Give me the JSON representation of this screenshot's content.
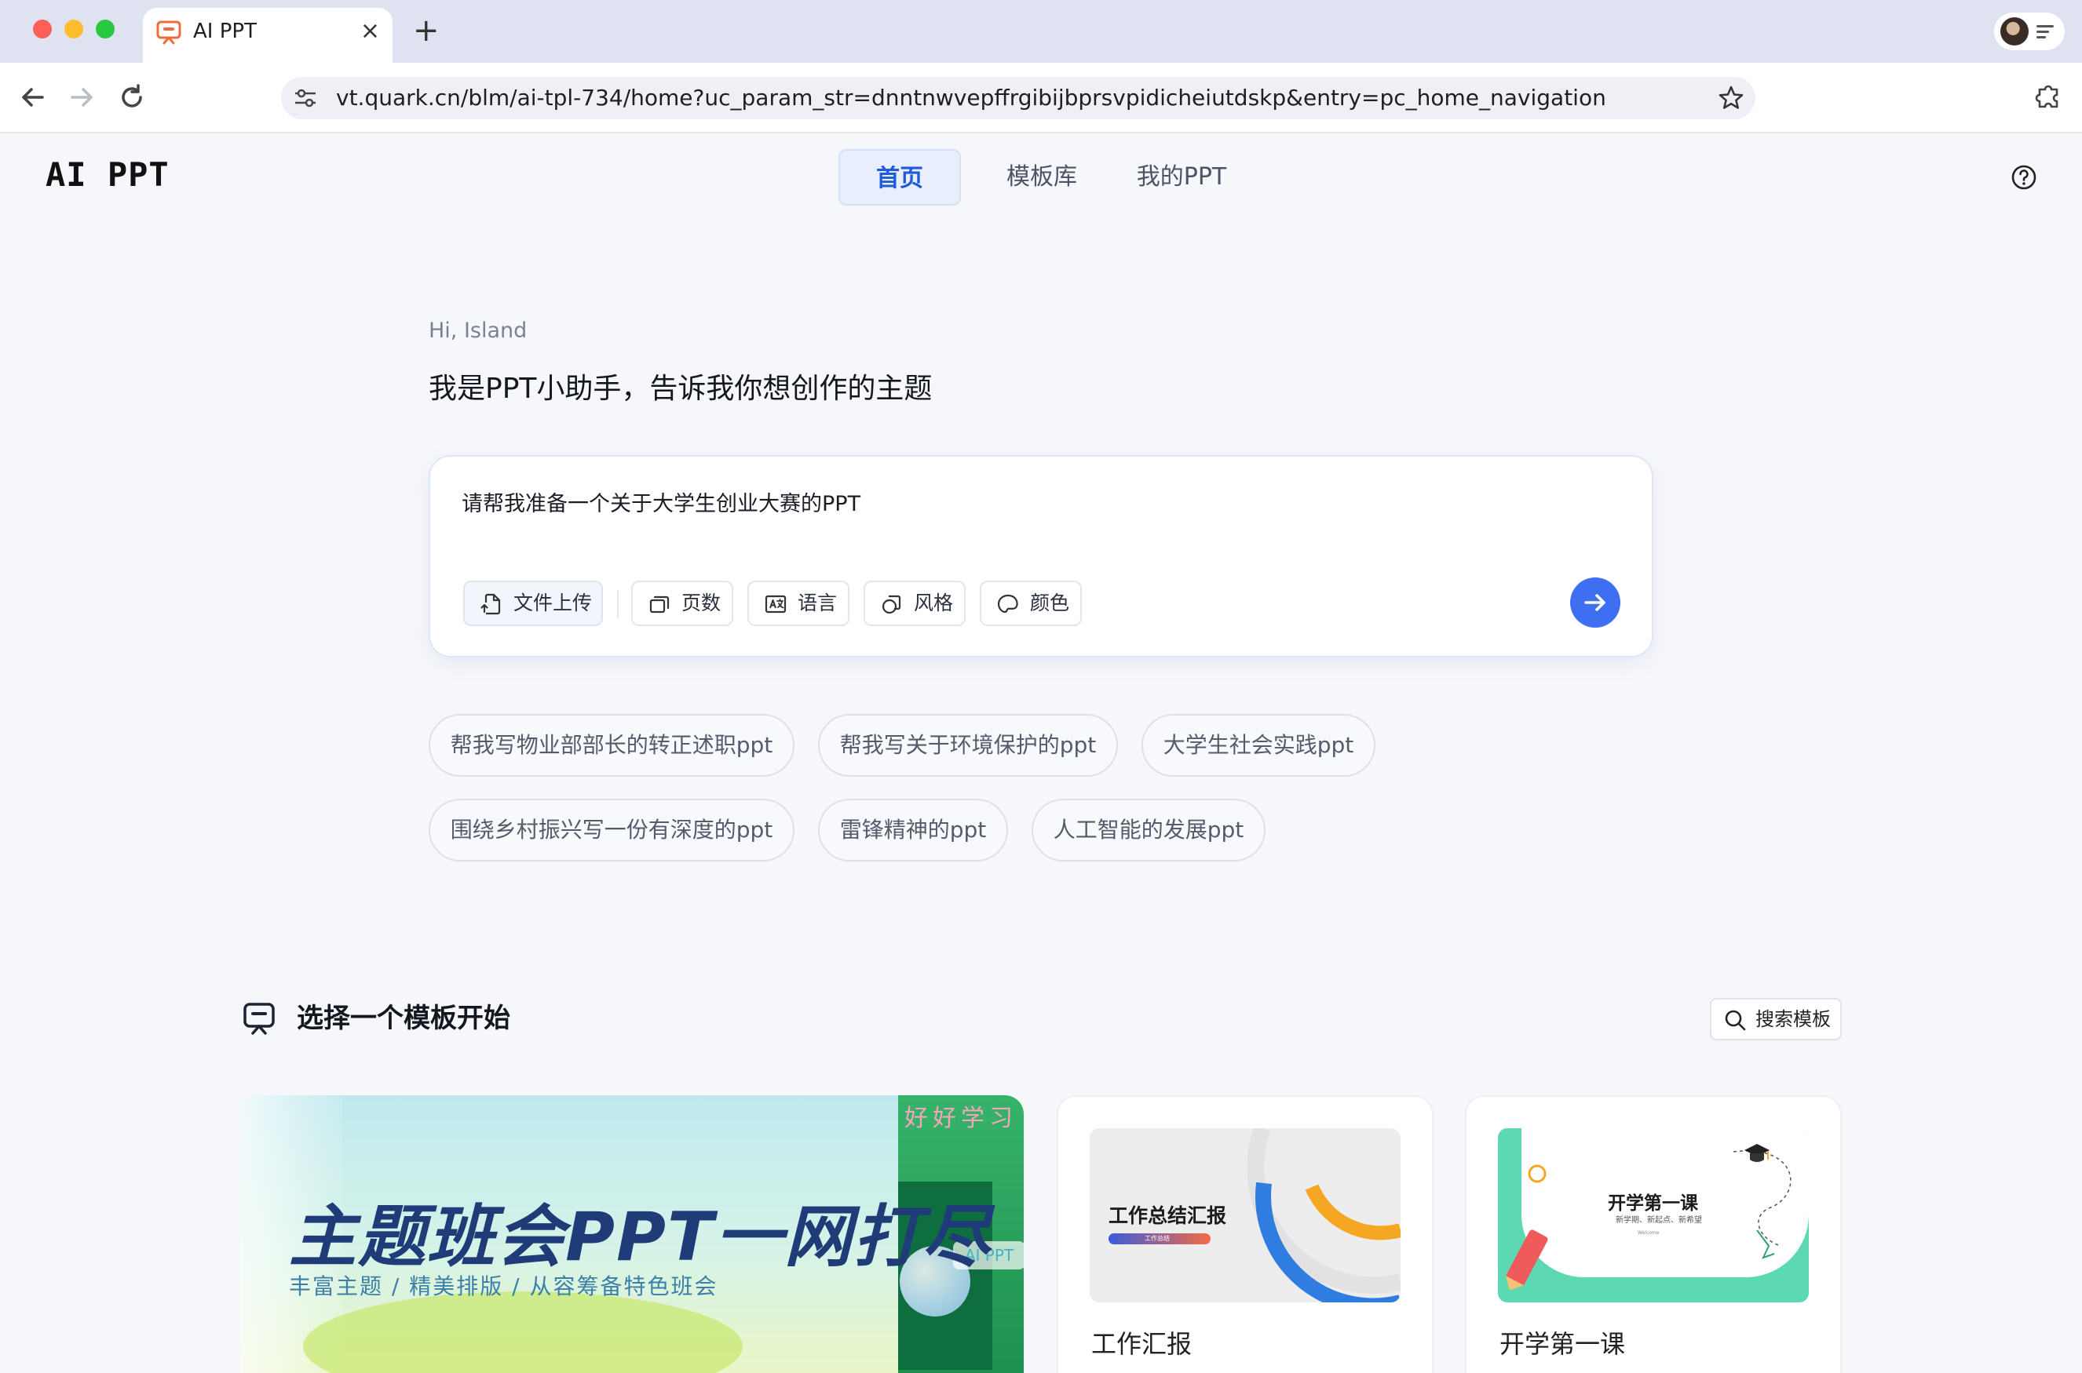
{
  "browser": {
    "tab_title": "AI PPT",
    "tab_close": "×",
    "new_tab": "+",
    "url": "vt.quark.cn/blm/ai-tpl-734/home?uc_param_str=dnntnwvepffrgibijbprsvpidicheiutdskp&entry=pc_home_navigation"
  },
  "header": {
    "logo": "AI PPT",
    "nav": [
      {
        "label": "首页",
        "active": true
      },
      {
        "label": "模板库",
        "active": false
      },
      {
        "label": "我的PPT",
        "active": false
      }
    ]
  },
  "hero": {
    "greeting": "Hi, Island",
    "subtitle": "我是PPT小助手，告诉我你想创作的主题",
    "prompt_value": "请帮我准备一个关于大学生创业大赛的PPT",
    "chips": {
      "upload": "文件上传",
      "pages": "页数",
      "language": "语言",
      "style": "风格",
      "color": "颜色"
    }
  },
  "suggestions": [
    "帮我写物业部部长的转正述职ppt",
    "帮我写关于环境保护的ppt",
    "大学生社会实践ppt",
    "围绕乡村振兴写一份有深度的ppt",
    "雷锋精神的ppt",
    "人工智能的发展ppt"
  ],
  "templates": {
    "section_title": "选择一个模板开始",
    "search_label": "搜索模板",
    "banner": {
      "headline": "主题班会PPT一网打尽",
      "tagline": "丰富主题 / 精美排版 / 从容筹备特色班会",
      "corner_text": "好好学习",
      "badge": "AI PPT"
    },
    "cards": [
      {
        "label": "工作汇报",
        "thumb_title": "工作总结汇报",
        "thumb_bar_text": "工作总结"
      },
      {
        "label": "开学第一课",
        "thumb_title": "开学第一课",
        "thumb_sub": "新学期、新起点、新希望",
        "thumb_small": "Welcome"
      }
    ]
  },
  "colors": {
    "accent": "#1f5ad8",
    "send_button": "#3d6ff0",
    "tab_icon": "#f26b3a"
  }
}
